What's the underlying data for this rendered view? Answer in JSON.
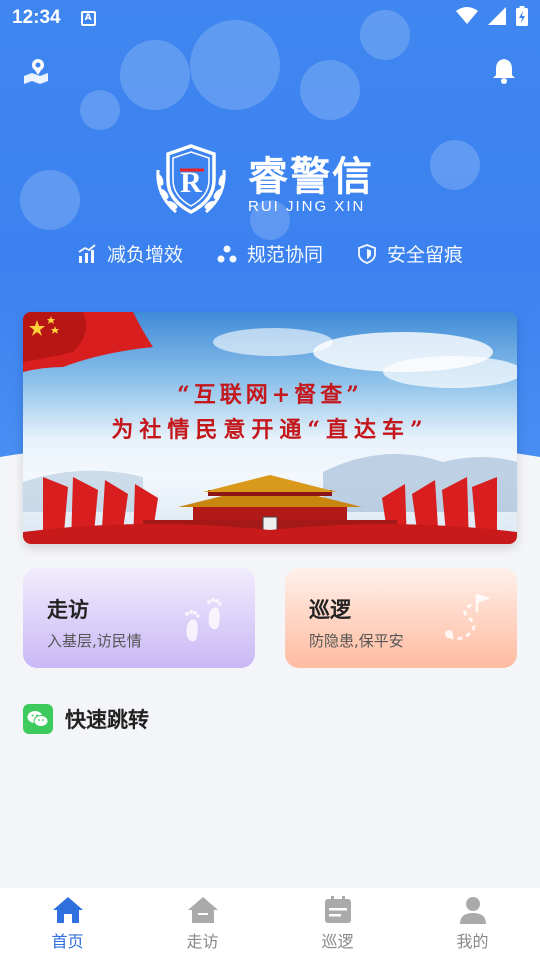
{
  "status_bar": {
    "time": "12:34",
    "notification_letter": "A"
  },
  "brand": {
    "name_cn": "睿警信",
    "name_en": "RUI JING XIN",
    "emblem_letter": "R"
  },
  "features": [
    {
      "icon": "chart-icon",
      "label": "减负增效"
    },
    {
      "icon": "network-icon",
      "label": "规范协同"
    },
    {
      "icon": "shield-icon",
      "label": "安全留痕"
    }
  ],
  "banner": {
    "line1": "“互联网+督查”",
    "line2": "为社情民意开通“直达车”"
  },
  "cards": {
    "visit": {
      "title": "走访",
      "subtitle": "入基层,访民情",
      "icon": "footprints-icon"
    },
    "patrol": {
      "title": "巡逻",
      "subtitle": "防隐患,保平安",
      "icon": "route-flag-icon"
    }
  },
  "quick_jump": {
    "title": "快速跳转"
  },
  "bottom_nav": [
    {
      "label": "首页",
      "icon": "home-icon",
      "active": true
    },
    {
      "label": "走访",
      "icon": "house-icon",
      "active": false
    },
    {
      "label": "巡逻",
      "icon": "calendar-icon",
      "active": false
    },
    {
      "label": "我的",
      "icon": "person-icon",
      "active": false
    }
  ],
  "colors": {
    "primary": "#3b82f0",
    "nav_active": "#2f6fde",
    "banner_text": "#c4171b"
  }
}
